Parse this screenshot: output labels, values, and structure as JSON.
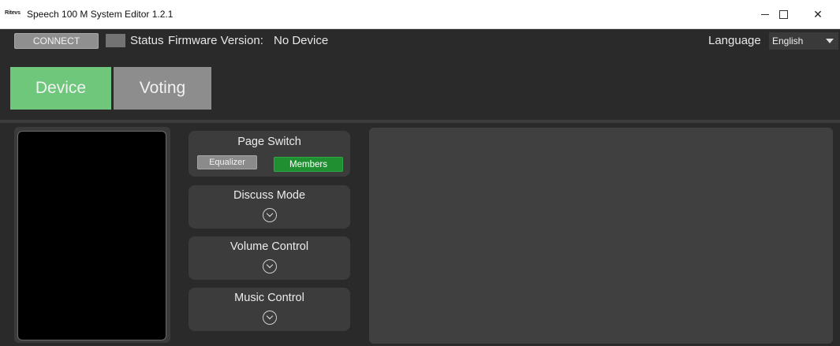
{
  "window": {
    "logo_text": "Ritevs",
    "title": "Speech 100 M System Editor 1.2.1",
    "controls": {
      "minimize": "–",
      "maximize": "☐",
      "close": "✕"
    }
  },
  "toolbar": {
    "connect_label": "CONNECT",
    "status_label": "Status",
    "firmware_label": "Firmware Version:",
    "firmware_value": "No Device",
    "language_label": "Language",
    "language_selected": "English"
  },
  "tabs": [
    {
      "label": "Device",
      "active": true
    },
    {
      "label": "Voting",
      "active": false
    }
  ],
  "groups": {
    "page_switch": {
      "title": "Page Switch",
      "equalizer_label": "Equalizer",
      "members_label": "Members"
    },
    "discuss_mode": {
      "title": "Discuss Mode",
      "icon": "chevron-down-circle-icon"
    },
    "volume_control": {
      "title": "Volume Control",
      "icon": "chevron-down-circle-icon"
    },
    "music_control": {
      "title": "Music Control",
      "icon": "chevron-down-circle-icon"
    }
  },
  "colors": {
    "background": "#2a2a2a",
    "device_tab": "#6ec77a",
    "voting_tab": "#8d8d8d",
    "members_button": "#1f8f31",
    "panel": "#3c3c3c"
  }
}
